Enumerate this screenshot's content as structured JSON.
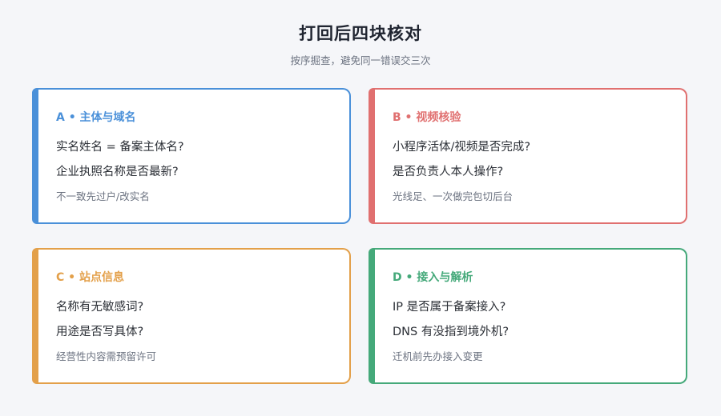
{
  "header": {
    "title": "打回后四块核对",
    "subtitle": "按序掘查，避免同一错误交三次"
  },
  "cards": [
    {
      "heading": "A • 主体与域名",
      "color": "#4a90d9",
      "lines": [
        "实名姓名 = 备案主体名?",
        "企业执照名称是否最新?"
      ],
      "note": "不一致先过户/改实名"
    },
    {
      "heading": "B • 视频核验",
      "color": "#e07070",
      "lines": [
        "小程序活体/视频是否完成?",
        "是否负责人本人操作?"
      ],
      "note": "光线足、一次做完包切后台"
    },
    {
      "heading": "C • 站点信息",
      "color": "#e3a04a",
      "lines": [
        "名称有无敏感词?",
        "用途是否写具体?"
      ],
      "note": "经营性内容需预留许可"
    },
    {
      "heading": "D • 接入与解析",
      "color": "#45a97a",
      "lines": [
        "IP 是否属于备案接入?",
        "DNS 有没指到境外机?"
      ],
      "note": "迁机前先办接入变更"
    }
  ]
}
